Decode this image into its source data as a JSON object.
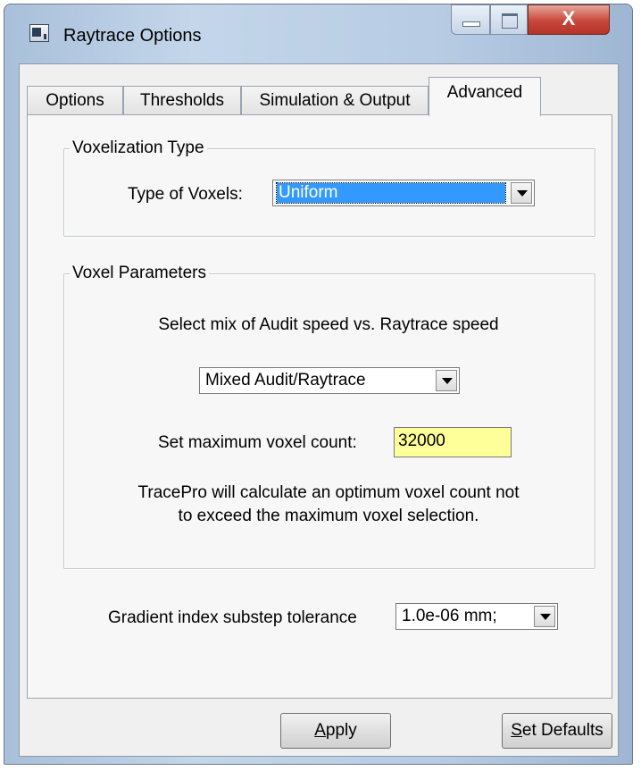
{
  "window": {
    "title": "Raytrace Options",
    "close_glyph": "X"
  },
  "tabs": [
    {
      "label": "Options"
    },
    {
      "label": "Thresholds"
    },
    {
      "label": "Simulation & Output"
    },
    {
      "label": "Advanced",
      "active": true
    }
  ],
  "voxelization": {
    "legend": "Voxelization Type",
    "type_label": "Type of Voxels:",
    "type_value": "Uniform"
  },
  "voxel_params": {
    "legend": "Voxel Parameters",
    "mix_label": "Select mix of Audit speed vs. Raytrace speed",
    "mix_value": "Mixed Audit/Raytrace",
    "max_label": "Set maximum voxel count:",
    "max_value": "32000",
    "note_line1": "TracePro will calculate an optimum voxel count not",
    "note_line2": "to exceed the maximum voxel selection."
  },
  "gradient": {
    "label": "Gradient index substep tolerance",
    "value": "1.0e-06 mm;"
  },
  "buttons": {
    "apply_mnemonic": "A",
    "apply_rest": "pply",
    "defaults_mnemonic": "S",
    "defaults_rest": "et Defaults"
  },
  "colors": {
    "selection": "#3399ff",
    "highlight_field": "#ffff99",
    "close_button": "#c8463a"
  },
  "icons": [
    "app-icon",
    "minimize-icon",
    "maximize-icon",
    "close-icon",
    "chevron-down-icon"
  ]
}
